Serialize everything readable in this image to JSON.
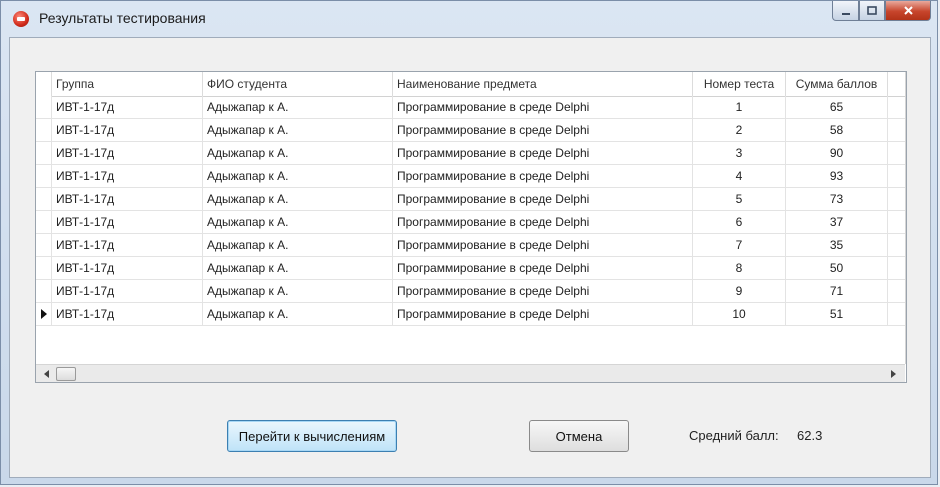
{
  "window": {
    "title": "Результаты тестирования"
  },
  "columns": [
    "Группа",
    "ФИО студента",
    "Наименование предмета",
    "Номер теста",
    "Сумма баллов"
  ],
  "rows": [
    {
      "group": "ИВТ-1-17д",
      "student": "Адыжапар к А.",
      "subject": "Программирование в среде Delphi",
      "test": "1",
      "score": "65"
    },
    {
      "group": "ИВТ-1-17д",
      "student": "Адыжапар к А.",
      "subject": "Программирование в среде Delphi",
      "test": "2",
      "score": "58"
    },
    {
      "group": "ИВТ-1-17д",
      "student": "Адыжапар к А.",
      "subject": "Программирование в среде Delphi",
      "test": "3",
      "score": "90"
    },
    {
      "group": "ИВТ-1-17д",
      "student": "Адыжапар к А.",
      "subject": "Программирование в среде Delphi",
      "test": "4",
      "score": "93"
    },
    {
      "group": "ИВТ-1-17д",
      "student": "Адыжапар к А.",
      "subject": "Программирование в среде Delphi",
      "test": "5",
      "score": "73"
    },
    {
      "group": "ИВТ-1-17д",
      "student": "Адыжапар к А.",
      "subject": "Программирование в среде Delphi",
      "test": "6",
      "score": "37"
    },
    {
      "group": "ИВТ-1-17д",
      "student": "Адыжапар к А.",
      "subject": "Программирование в среде Delphi",
      "test": "7",
      "score": "35"
    },
    {
      "group": "ИВТ-1-17д",
      "student": "Адыжапар к А.",
      "subject": "Программирование в среде Delphi",
      "test": "8",
      "score": "50"
    },
    {
      "group": "ИВТ-1-17д",
      "student": "Адыжапар к А.",
      "subject": "Программирование в среде Delphi",
      "test": "9",
      "score": "71"
    },
    {
      "group": "ИВТ-1-17д",
      "student": "Адыжапар к А.",
      "subject": "Программирование в среде Delphi",
      "test": "10",
      "score": "51"
    }
  ],
  "current_row": 9,
  "buttons": {
    "compute": "Перейти к вычислениям",
    "cancel": "Отмена"
  },
  "average": {
    "label": "Средний балл:",
    "value": "62.3"
  },
  "icons": {
    "app": "app-icon",
    "minimize": "minimize-icon",
    "maximize": "maximize-icon",
    "close": "close-icon",
    "row_pointer": "row-pointer-icon"
  }
}
